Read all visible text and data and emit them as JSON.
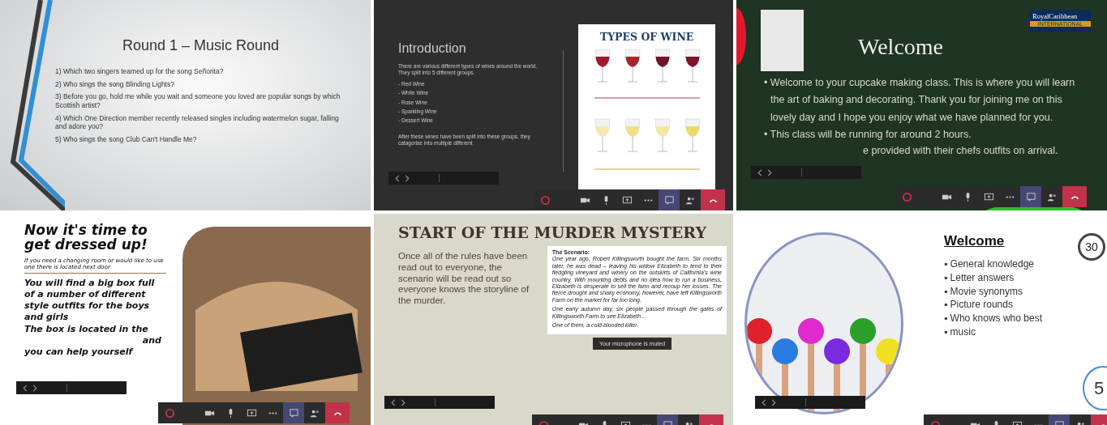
{
  "slides": [
    {
      "kind": "music_round",
      "title": "Round 1 – Music Round",
      "questions": [
        "1) Which two singers teamed up for the song Señorita?",
        "2) Who sings the song Blinding Lights?",
        "3) Before you go, hold me while you wait and someone you loved are popular songs by which Scottish artist?",
        "4) Which One Direction member recently released singles including watermelon sugar, falling and adore you?",
        "5) Who sings the song Club Can't Handle Me?"
      ]
    },
    {
      "kind": "wine_intro",
      "title": "Introduction",
      "intro": "There are various different types of wines around the world. They split into 5 different groups.",
      "list": [
        "- Red Wine",
        "- White Wine",
        "- Rose Wine",
        "- Sparkling Wine",
        "- Dessert Wine"
      ],
      "outro": "After these wines have been split into these groups, they catagorise into multiple different",
      "poster_title": "TYPES OF WINE",
      "slide_nav": true,
      "call_controls": true
    },
    {
      "kind": "cupcake_welcome",
      "title": "Welcome",
      "bullets": [
        "• Welcome to your cupcake making class. This is where you will learn the art of baking and decorating. Thank you for joining me on this lovely day and I hope you enjoy what we have planned for you.",
        "• This class will be running for around 2 hours."
      ],
      "covered_line": "e provided with their chefs outfits on arrival.",
      "logo_name": "RoyalCaribbean",
      "logo_tagline": "INTERNATIONAL",
      "slide_nav": true,
      "call_controls": true
    },
    {
      "kind": "dress_up",
      "title": "Now it's time to get dressed up!",
      "note": "If you need a changing room or would like to use one there is located next door",
      "body": "You will find a big box full of a number of different style outfits for the boys and girls",
      "lines": [
        "The box is located in the",
        "and",
        "you can help yourself"
      ],
      "slide_nav": true,
      "call_controls": true
    },
    {
      "kind": "murder_mystery",
      "title": "START OF THE MURDER MYSTERY",
      "body": "Once all of the rules have been read out to everyone, the scenario will be read out so everyone knows the storyline of the murder.",
      "scenario_heading": "The Scenario:",
      "scenario": [
        "One year ago, Robert Killingsworth bought the farm. Six months later, he was dead – leaving his widow Elizabeth to tend to their fledgling vineyard and winery on the outskirts of California's wine country. With mounting debts and no idea how to run a business, Elizabeth is desperate to sell the farm and recoup her losses. The fierce drought and shaky economy, however, have left Killingsworth Farm on the market for far too long.",
        "One early autumn day, six people passed through the gates of Killingsworth Farm to see Elizabeth…",
        "One of them, a cold-blooded killer."
      ],
      "notice": "Your microphone is muted",
      "slide_nav": true,
      "call_controls": true
    },
    {
      "kind": "quiz_welcome",
      "title": "Welcome",
      "bullets": [
        "▪ General knowledge",
        "▪ Letter answers",
        "▪ Movie synonyms",
        "▪ Picture rounds",
        "▪ Who knows who best",
        "▪ music"
      ],
      "timer": "30",
      "badge": "5",
      "slide_nav": true,
      "call_controls": true
    }
  ]
}
